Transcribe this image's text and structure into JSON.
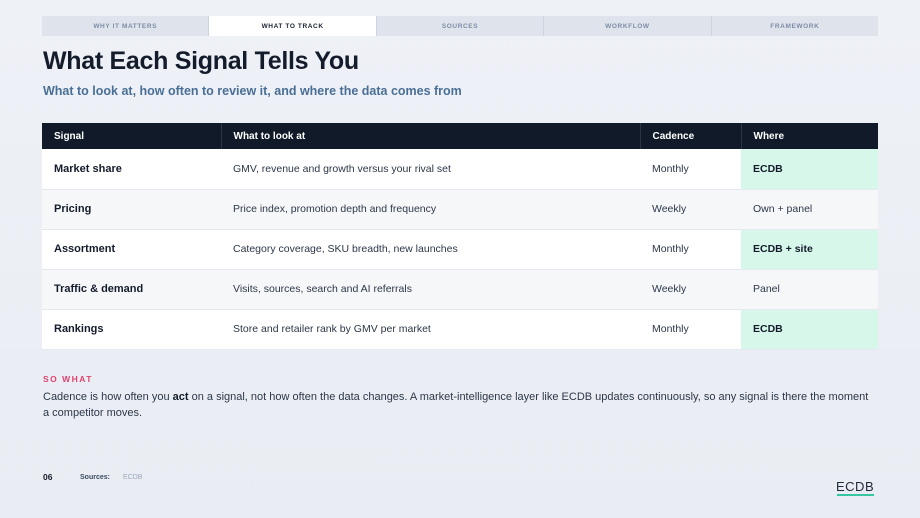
{
  "tabs": [
    "WHY IT MATTERS",
    "WHAT TO TRACK",
    "SOURCES",
    "WORKFLOW",
    "FRAMEWORK"
  ],
  "title": "What Each Signal Tells You",
  "subtitle": "What to look at, how often to review it, and where the data comes from",
  "table": {
    "headers": [
      "Signal",
      "What to look at",
      "Cadence",
      "Where"
    ],
    "rows": [
      [
        "Market share",
        "GMV, revenue and growth versus your rival set",
        "Monthly",
        "ECDB"
      ],
      [
        "Pricing",
        "Price index, promotion depth and frequency",
        "Weekly",
        "Own + panel"
      ],
      [
        "Assortment",
        "Category coverage, SKU breadth, new launches",
        "Monthly",
        "ECDB + site"
      ],
      [
        "Traffic & demand",
        "Visits, sources, search and AI referrals",
        "Weekly",
        "Panel"
      ],
      [
        "Rankings",
        "Store and retailer rank by GMV per market",
        "Monthly",
        "ECDB"
      ]
    ]
  },
  "so_what": {
    "label": "SO WHAT",
    "text_before": "Cadence is how often you ",
    "text_bold": "act",
    "text_after": " on a signal, not how often the data changes. A market-intelligence layer like ECDB updates continuously, so any signal is there the moment a competitor moves."
  },
  "footer": {
    "page_number": "06",
    "sources_label": "Sources:",
    "sources_value": "ECDB",
    "logo": "ECDB"
  },
  "colors": {
    "header_bg": "#111a28",
    "highlight": "#d6f7e9",
    "accent_pink": "#e0416e",
    "accent_green": "#36c6a0"
  }
}
